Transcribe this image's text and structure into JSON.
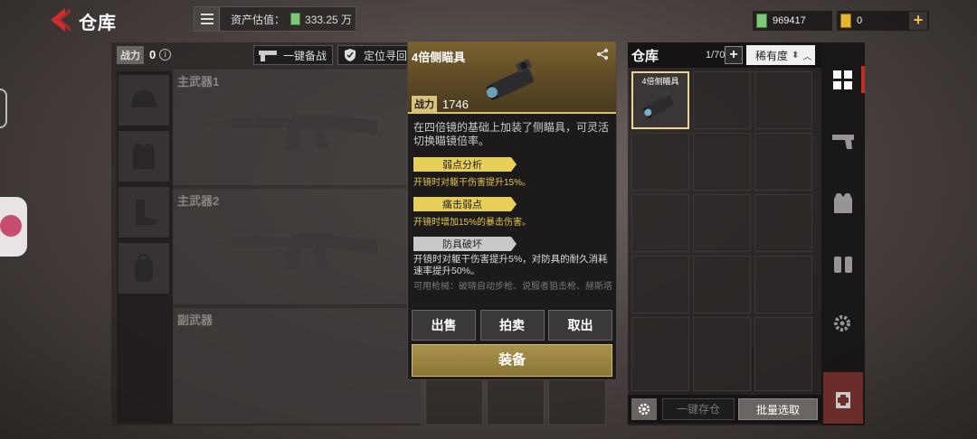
{
  "header": {
    "title": "仓库",
    "asset_label": "资产估值：",
    "asset_value": "333.25 万",
    "cash_value": "969417",
    "coupon_value": "0"
  },
  "loadout": {
    "power_label": "战力",
    "power_value": "0",
    "quick_button": "一键备战",
    "locate_button": "定位寻回",
    "slots": [
      {
        "label": "主武器1"
      },
      {
        "label": "主武器2"
      },
      {
        "label": "副武器"
      }
    ]
  },
  "detail": {
    "name": "4倍侧瞄具",
    "power_label": "战力",
    "power_value": "1746",
    "description": "在四倍镜的基础上加装了侧瞄具，可灵活切换瞄镜倍率。",
    "traits": [
      {
        "name": "弱点分析",
        "desc": "开镜时对躯干伤害提升15%。",
        "tier": "gold"
      },
      {
        "name": "痛击弱点",
        "desc": "开镜时增加15%的暴击伤害。",
        "tier": "gold"
      },
      {
        "name": "防具破坏",
        "desc": "开镜时对躯干伤害提升5%，对防具的耐久消耗速率提升50%。",
        "tier": "silver"
      }
    ],
    "usable": "可用枪械：破晓自动步枪、说服者狙击枪、赫斯塔冲锋枪、夜魔卡宾枪、重踏狙击枪、响箭步枪、猎鹰栓动步枪、灰狼轻机枪、闪电突击步",
    "actions": [
      "出售",
      "拍卖",
      "取出"
    ],
    "equip": "装备"
  },
  "warehouse": {
    "title": "仓库",
    "count": "1/70",
    "sort_label": "稀有度",
    "item_name": "4倍侧瞄具",
    "deposit_button": "一键存仓",
    "batch_button": "批量选取"
  },
  "colors": {
    "accent_red": "#c42c2c",
    "gold": "#e8cf5a",
    "equip_gold": "#a8924b"
  },
  "icons": [
    "back-icon",
    "menu-icon",
    "cash-icon",
    "coupon-icon",
    "plus-icon",
    "info-icon",
    "share-icon",
    "gear-icon",
    "grid-icon",
    "pistol-icon",
    "vest-icon",
    "backpack-icon",
    "attachment-icon",
    "medical-icon"
  ]
}
